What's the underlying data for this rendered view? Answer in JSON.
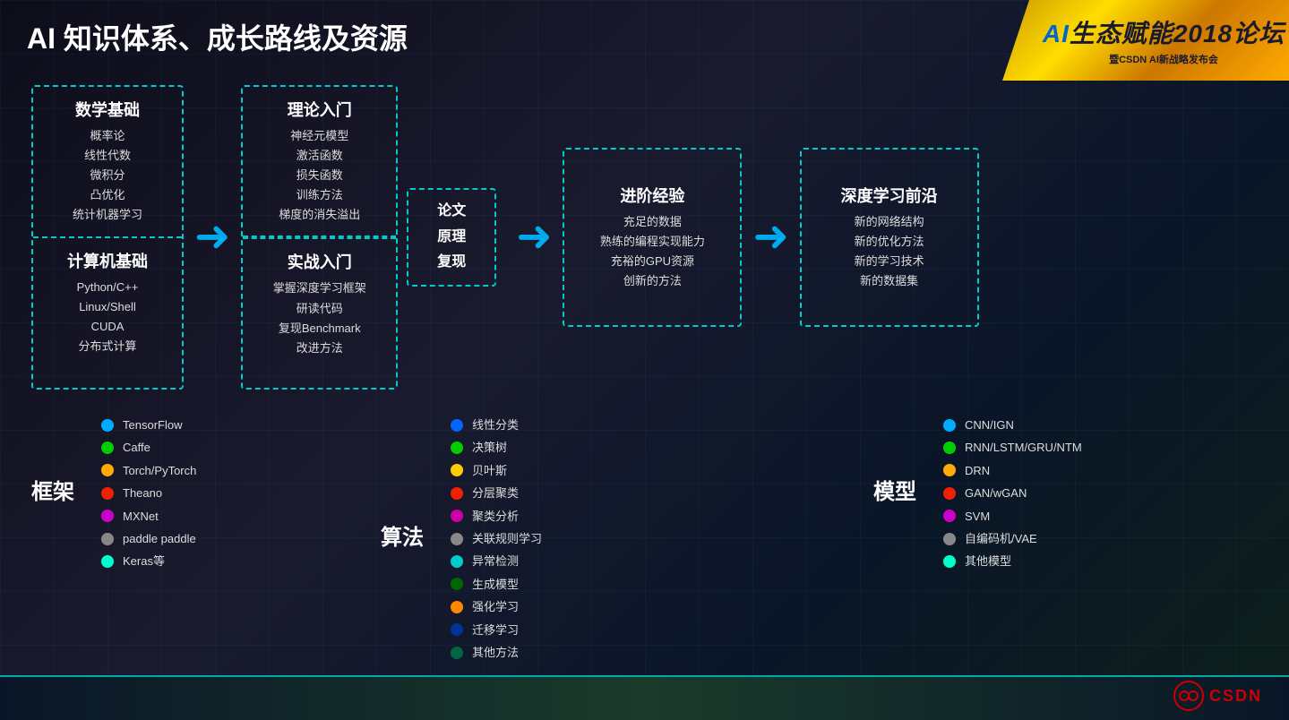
{
  "title": "AI 知识体系、成长路线及资源",
  "logo": {
    "main_prefix": "AI",
    "main_text": "生态赋能2018论坛",
    "sub": "暨CSDN AI新战略发布会"
  },
  "flow": {
    "math_title": "数学基础",
    "math_items": [
      "概率论",
      "线性代数",
      "微积分",
      "凸优化",
      "统计机器学习"
    ],
    "computer_title": "计算机基础",
    "computer_items": [
      "Python/C++",
      "Linux/Shell",
      "CUDA",
      "分布式计算"
    ],
    "theory_title": "理论入门",
    "theory_items": [
      "神经元模型",
      "激活函数",
      "损失函数",
      "训练方法",
      "梯度的消失溢出"
    ],
    "practice_title": "实战入门",
    "practice_items": [
      "掌握深度学习框架",
      "研读代码",
      "复现Benchmark",
      "改进方法"
    ],
    "paper_title": "论文\n原理\n复现",
    "advanced_title": "进阶经验",
    "advanced_items": [
      "充足的数据",
      "熟练的编程实现能力",
      "充裕的GPU资源",
      "创新的方法"
    ],
    "deep_title": "深度学习前沿",
    "deep_items": [
      "新的网络结构",
      "新的优化方法",
      "新的学习技术",
      "新的数据集"
    ]
  },
  "frameworks": {
    "section_title": "框架",
    "items": [
      {
        "color": "#00aaff",
        "label": "TensorFlow"
      },
      {
        "color": "#00cc00",
        "label": "Caffe"
      },
      {
        "color": "#ffaa00",
        "label": "Torch/PyTorch"
      },
      {
        "color": "#ee2200",
        "label": "Theano"
      },
      {
        "color": "#cc00cc",
        "label": "MXNet"
      },
      {
        "color": "#888888",
        "label": "paddle paddle"
      },
      {
        "color": "#00ffcc",
        "label": "Keras等"
      }
    ]
  },
  "algorithms": {
    "section_title": "算法",
    "items": [
      {
        "color": "#0066ff",
        "label": "线性分类"
      },
      {
        "color": "#00cc00",
        "label": "决策树"
      },
      {
        "color": "#ffcc00",
        "label": "贝叶斯"
      },
      {
        "color": "#ee2200",
        "label": "分层聚类"
      },
      {
        "color": "#cc00aa",
        "label": "聚类分析"
      },
      {
        "color": "#888888",
        "label": "关联规则学习"
      },
      {
        "color": "#00cccc",
        "label": "异常检测"
      },
      {
        "color": "#006600",
        "label": "生成模型"
      },
      {
        "color": "#ff8800",
        "label": "强化学习"
      },
      {
        "color": "#003399",
        "label": "迁移学习"
      },
      {
        "color": "#006644",
        "label": "其他方法"
      }
    ]
  },
  "models": {
    "section_title": "模型",
    "items": [
      {
        "color": "#00aaff",
        "label": "CNN/IGN"
      },
      {
        "color": "#00cc00",
        "label": "RNN/LSTM/GRU/NTM"
      },
      {
        "color": "#ffaa00",
        "label": "DRN"
      },
      {
        "color": "#ee2200",
        "label": "GAN/wGAN"
      },
      {
        "color": "#cc00cc",
        "label": "SVM"
      },
      {
        "color": "#888888",
        "label": "自编码机/VAE"
      },
      {
        "color": "#00ffcc",
        "label": "其他模型"
      }
    ]
  }
}
